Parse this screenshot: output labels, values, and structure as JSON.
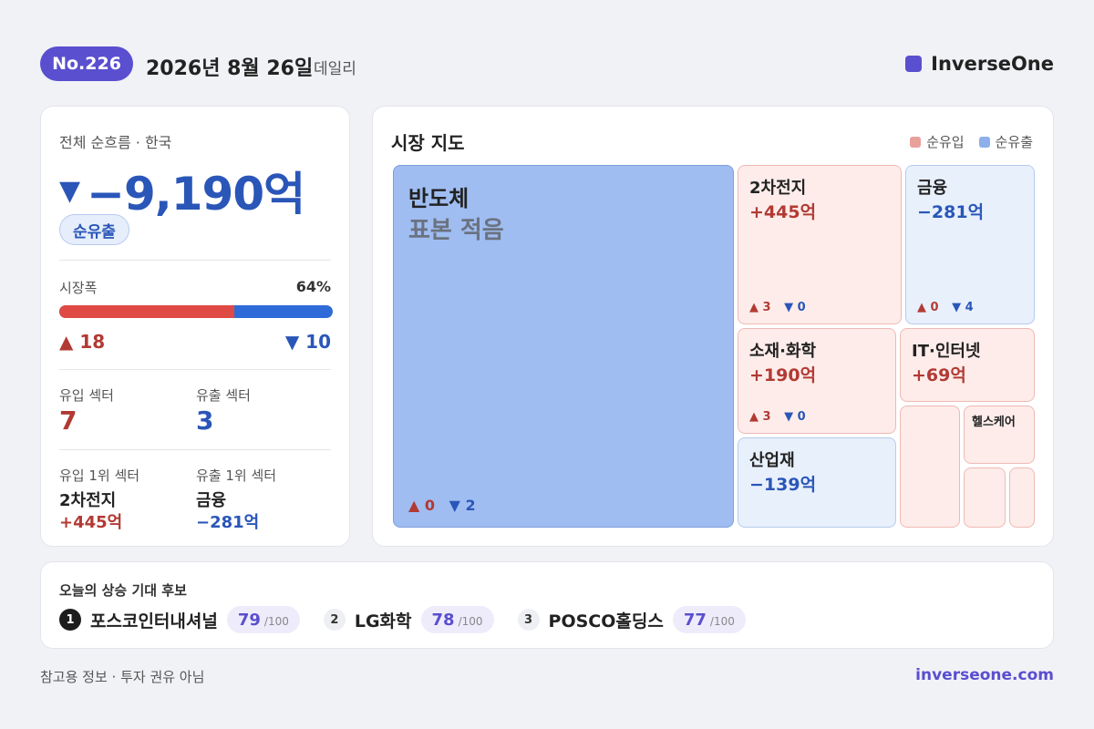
{
  "header": {
    "issue": "No.226",
    "date": "2026년 8월 26일",
    "period": "데일리",
    "brand": "InverseOne",
    "brand_color": "#5a4fcf"
  },
  "summary": {
    "kicker": "전체 순흐름 · 한국",
    "direction_icon": "▼",
    "net_flow": "−9,190억",
    "net_flow_label": "순유출",
    "breadth_label": "시장폭",
    "breadth_pct": "64%",
    "breadth_fraction": 0.64,
    "up_count": "▲ 18",
    "down_count": "▼ 10",
    "inflow_sectors_label": "유입 섹터",
    "inflow_sectors": "7",
    "outflow_sectors_label": "유출 섹터",
    "outflow_sectors": "3",
    "top_inflow_label": "유입 1위 섹터",
    "top_inflow_name": "2차전지",
    "top_inflow_amount": "+445억",
    "top_outflow_label": "유출 1위 섹터",
    "top_outflow_name": "금융",
    "top_outflow_amount": "−281억"
  },
  "market_map": {
    "title": "시장 지도",
    "legend_in": "순유입",
    "legend_out": "순유출",
    "legend_in_color": "#e8a09b",
    "legend_out_color": "#8db0ea",
    "tiles": {
      "semis": {
        "name": "반도체",
        "note": "표본 적음",
        "up": "▲ 0",
        "down": "▼ 2"
      },
      "battery": {
        "name": "2차전지",
        "amount": "+445억",
        "up": "▲ 3",
        "down": "▼ 0"
      },
      "finance": {
        "name": "금융",
        "amount": "−281억",
        "up": "▲ 0",
        "down": "▼ 4"
      },
      "chem": {
        "name": "소재·화학",
        "amount": "+190억",
        "up": "▲ 3",
        "down": "▼ 0"
      },
      "it": {
        "name": "IT·인터넷",
        "amount": "+69억"
      },
      "industrial": {
        "name": "산업재",
        "amount": "−139억"
      },
      "health": {
        "name": "헬스케어"
      }
    }
  },
  "picks": {
    "title": "오늘의 상승 기대 후보",
    "items": [
      {
        "rank": "1",
        "name": "포스코인터내셔널",
        "score": "79",
        "max": "/100"
      },
      {
        "rank": "2",
        "name": "LG화학",
        "score": "78",
        "max": "/100"
      },
      {
        "rank": "3",
        "name": "POSCO홀딩스",
        "score": "77",
        "max": "/100"
      }
    ]
  },
  "footer": {
    "note": "참고용 정보 · 투자 권유 아님",
    "url": "inverseone.com"
  }
}
